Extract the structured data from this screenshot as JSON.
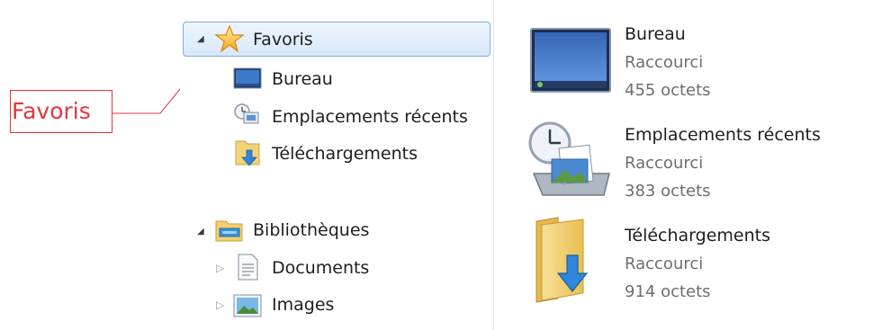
{
  "annotation": {
    "label": "Favoris"
  },
  "nav": {
    "favorites": {
      "label": "Favoris",
      "items": [
        {
          "label": "Bureau",
          "icon": "desktop-icon"
        },
        {
          "label": "Emplacements récents",
          "icon": "recent-places-icon"
        },
        {
          "label": "Téléchargements",
          "icon": "downloads-folder-icon"
        }
      ]
    },
    "libraries": {
      "label": "Bibliothèques",
      "items": [
        {
          "label": "Documents",
          "icon": "documents-icon"
        },
        {
          "label": "Images",
          "icon": "pictures-icon"
        }
      ]
    }
  },
  "content": {
    "items": [
      {
        "name": "Bureau",
        "type": "Raccourci",
        "size": "455 octets",
        "icon": "desktop-large-icon"
      },
      {
        "name": "Emplacements récents",
        "type": "Raccourci",
        "size": "383 octets",
        "icon": "recent-places-large-icon"
      },
      {
        "name": "Téléchargements",
        "type": "Raccourci",
        "size": "914 octets",
        "icon": "downloads-folder-large-icon"
      }
    ]
  },
  "colors": {
    "annotation": "#e0363b",
    "selection_border": "#84acdd",
    "secondary_text": "#6d6d6d"
  }
}
